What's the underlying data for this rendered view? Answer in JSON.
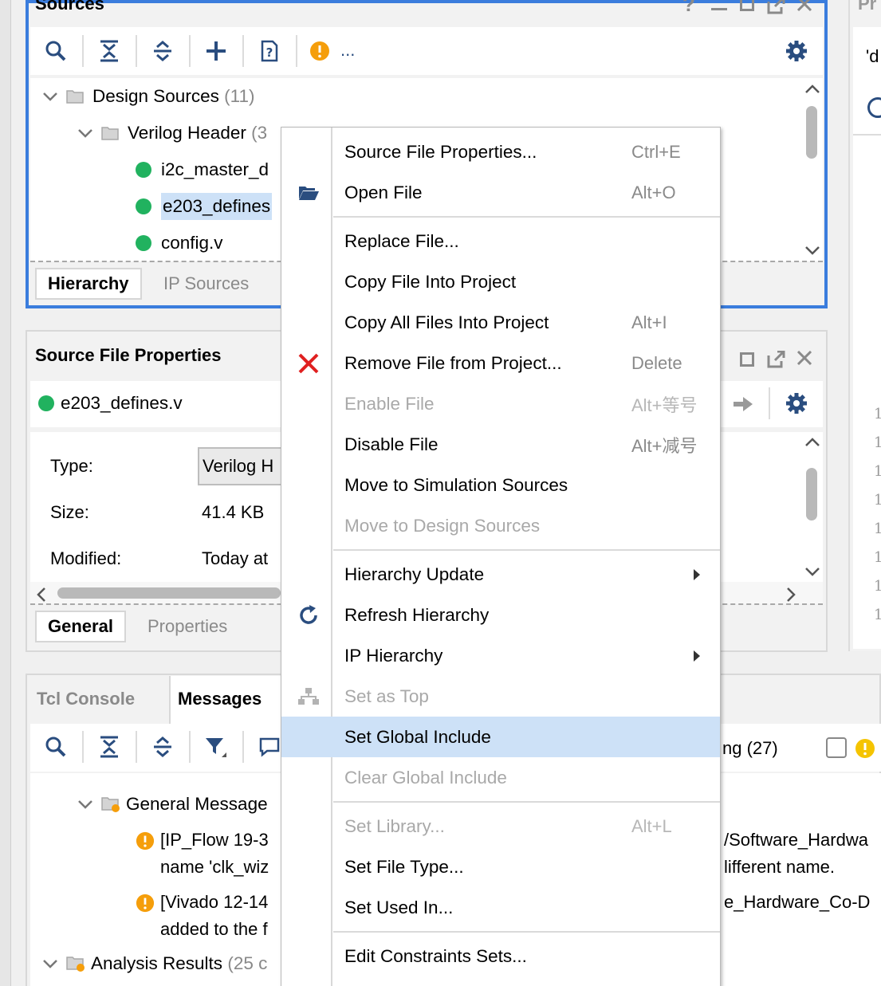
{
  "sources_panel": {
    "title": "Sources",
    "toolbar_more": "...",
    "tree": [
      {
        "label": "Design Sources",
        "count": "(11)"
      },
      {
        "label": "Verilog Header",
        "count": "(3"
      },
      {
        "label": "i2c_master_d"
      },
      {
        "label": "e203_defines"
      },
      {
        "label": "config.v"
      }
    ],
    "tabs": [
      "Hierarchy",
      "IP Sources"
    ]
  },
  "right_panel": {
    "title_fragment": "Pr",
    "text_fragment": "'d",
    "line_numbers": [
      "1",
      "1",
      "1",
      "1",
      "1",
      "1",
      "1",
      "1"
    ]
  },
  "properties_panel": {
    "title": "Source File Properties",
    "file_name": "e203_defines.v",
    "fields": [
      {
        "label": "Type:",
        "value": "Verilog H"
      },
      {
        "label": "Size:",
        "value": "41.4 KB"
      },
      {
        "label": "Modified:",
        "value": "Today at"
      }
    ],
    "tabs": [
      "General",
      "Properties"
    ]
  },
  "messages_panel": {
    "tabs": [
      "Tcl Console",
      "Messages"
    ],
    "warning_count_fragment": "ng (27)",
    "tree": [
      {
        "label": "General Message"
      },
      {
        "line1": "[IP_Flow 19-3",
        "line2": "name 'clk_wiz",
        "tail1": "/Software_Hardwa",
        "tail2": "lifferent name."
      },
      {
        "line1": "[Vivado 12-14",
        "line2": "added to the f",
        "tail1": "e_Hardware_Co-D"
      },
      {
        "label": "Analysis Results",
        "count": "(25 c"
      }
    ]
  },
  "context_menu": {
    "items": [
      {
        "label": "Source File Properties...",
        "shortcut": "Ctrl+E",
        "icon": "",
        "disabled": false
      },
      {
        "label": "Open File",
        "shortcut": "Alt+O",
        "icon": "folder-open-icon",
        "disabled": false
      },
      {
        "label": "Replace File...",
        "shortcut": "",
        "icon": "",
        "disabled": false
      },
      {
        "label": "Copy File Into Project",
        "shortcut": "",
        "icon": "",
        "disabled": false
      },
      {
        "label": "Copy All Files Into Project",
        "shortcut": "Alt+I",
        "icon": "",
        "disabled": false
      },
      {
        "label": "Remove File from Project...",
        "shortcut": "Delete",
        "icon": "remove-x-icon",
        "disabled": false
      },
      {
        "label": "Enable File",
        "shortcut": "Alt+等号",
        "icon": "",
        "disabled": true
      },
      {
        "label": "Disable File",
        "shortcut": "Alt+减号",
        "icon": "",
        "disabled": false
      },
      {
        "label": "Move to Simulation Sources",
        "shortcut": "",
        "icon": "",
        "disabled": false
      },
      {
        "label": "Move to Design Sources",
        "shortcut": "",
        "icon": "",
        "disabled": true
      },
      {
        "label": "Hierarchy Update",
        "shortcut": "",
        "icon": "",
        "disabled": false,
        "submenu": true
      },
      {
        "label": "Refresh Hierarchy",
        "shortcut": "",
        "icon": "refresh-icon",
        "disabled": false
      },
      {
        "label": "IP Hierarchy",
        "shortcut": "",
        "icon": "",
        "disabled": false,
        "submenu": true
      },
      {
        "label": "Set as Top",
        "shortcut": "",
        "icon": "hierarchy-icon",
        "disabled": true
      },
      {
        "label": "Set Global Include",
        "shortcut": "",
        "icon": "",
        "disabled": false,
        "highlighted": true
      },
      {
        "label": "Clear Global Include",
        "shortcut": "",
        "icon": "",
        "disabled": true
      },
      {
        "label": "Set Library...",
        "shortcut": "Alt+L",
        "icon": "",
        "disabled": true
      },
      {
        "label": "Set File Type...",
        "shortcut": "",
        "icon": "",
        "disabled": false
      },
      {
        "label": "Set Used In...",
        "shortcut": "",
        "icon": "",
        "disabled": false
      },
      {
        "label": "Edit Constraints Sets...",
        "shortcut": "",
        "icon": "",
        "disabled": false
      }
    ]
  },
  "colors": {
    "accent_blue": "#3b7ddd",
    "highlight": "#cde1f7",
    "status_green": "#21b25f",
    "warning_orange": "#f59e0b",
    "remove_red": "#e02020"
  }
}
